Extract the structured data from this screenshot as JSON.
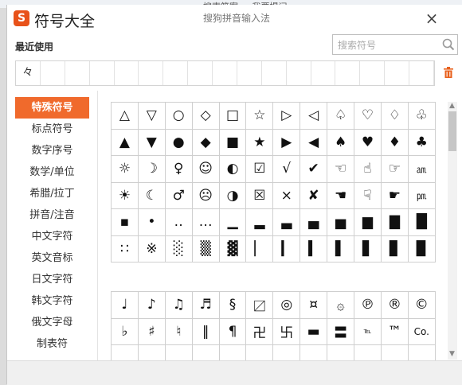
{
  "background": {
    "tabs": [
      "搜索答案",
      "我要提问"
    ]
  },
  "window": {
    "logo_letter": "S",
    "title": "符号大全",
    "ime_name": "搜狗拼音输入法",
    "close_glyph": "×"
  },
  "recent": {
    "label": "最近使用",
    "items": [
      "々",
      "",
      "",
      "",
      "",
      "",
      "",
      "",
      "",
      "",
      "",
      "",
      "",
      "",
      "",
      "",
      ""
    ]
  },
  "search": {
    "placeholder": "搜索符号"
  },
  "sidebar": {
    "items": [
      {
        "label": "特殊符号",
        "active": true
      },
      {
        "label": "标点符号"
      },
      {
        "label": "数字序号"
      },
      {
        "label": "数学/单位"
      },
      {
        "label": "希腊/拉丁"
      },
      {
        "label": "拼音/注音"
      },
      {
        "label": "中文字符"
      },
      {
        "label": "英文音标"
      },
      {
        "label": "日文字符"
      },
      {
        "label": "韩文字符"
      },
      {
        "label": "俄文字母"
      },
      {
        "label": "制表符"
      }
    ]
  },
  "symbols_group1": [
    "△",
    "▽",
    "○",
    "◇",
    "□",
    "☆",
    "▷",
    "◁",
    "♤",
    "♡",
    "♢",
    "♧",
    "▲",
    "▼",
    "●",
    "◆",
    "■",
    "★",
    "▶",
    "◀",
    "♠",
    "♥",
    "♦",
    "♣",
    "☼",
    "☽",
    "♀",
    "☺",
    "◐",
    "☑",
    "√",
    "✔",
    "☜",
    "☝",
    "☞",
    "㏂",
    "☀",
    "☾",
    "♂",
    "☹",
    "◑",
    "☒",
    "×",
    "✘",
    "☚",
    "☟",
    "☛",
    "㏘",
    "▪",
    "•",
    "‥",
    "…",
    "▁",
    "▂",
    "▃",
    "▄",
    "▅",
    "▆",
    "▇",
    "█",
    "∷",
    "※",
    "░",
    "▒",
    "▓",
    "▏",
    "▎",
    "▍",
    "▌",
    "▋",
    "▊",
    "▉"
  ],
  "symbols_group2": [
    "♩",
    "♪",
    "♫",
    "♬",
    "§",
    "〼",
    "◎",
    "¤",
    "۞",
    "℗",
    "®",
    "©",
    "♭",
    "♯",
    "♮",
    "‖",
    "¶",
    "卍",
    "卐",
    "▬",
    "〓",
    "℡",
    "™",
    "Co.",
    "",
    "",
    "",
    "",
    "",
    "",
    "",
    "",
    "",
    "",
    "",
    ""
  ]
}
